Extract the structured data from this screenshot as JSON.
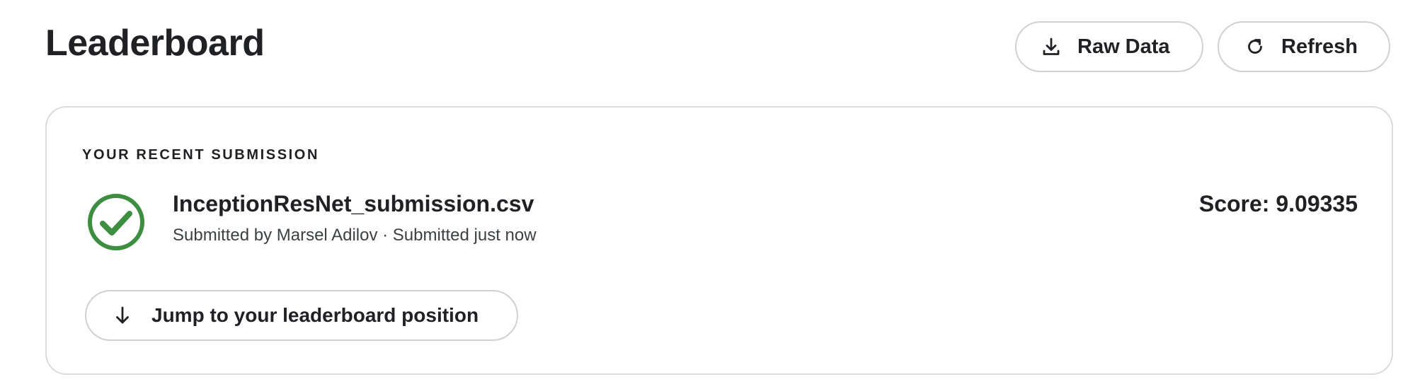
{
  "header": {
    "title": "Leaderboard",
    "raw_data_label": "Raw Data",
    "raw_data_icon": "download-icon",
    "refresh_label": "Refresh",
    "refresh_icon": "refresh-icon"
  },
  "recent_submission": {
    "section_label": "YOUR RECENT SUBMISSION",
    "status_icon": "check-circle-icon",
    "status_color": "#3e8e41",
    "file_name": "InceptionResNet_submission.csv",
    "meta": "Submitted by Marsel Adilov · Submitted just now",
    "score": "Score: 9.09335",
    "jump_label": "Jump to your leaderboard position",
    "jump_icon": "arrow-down-icon"
  }
}
